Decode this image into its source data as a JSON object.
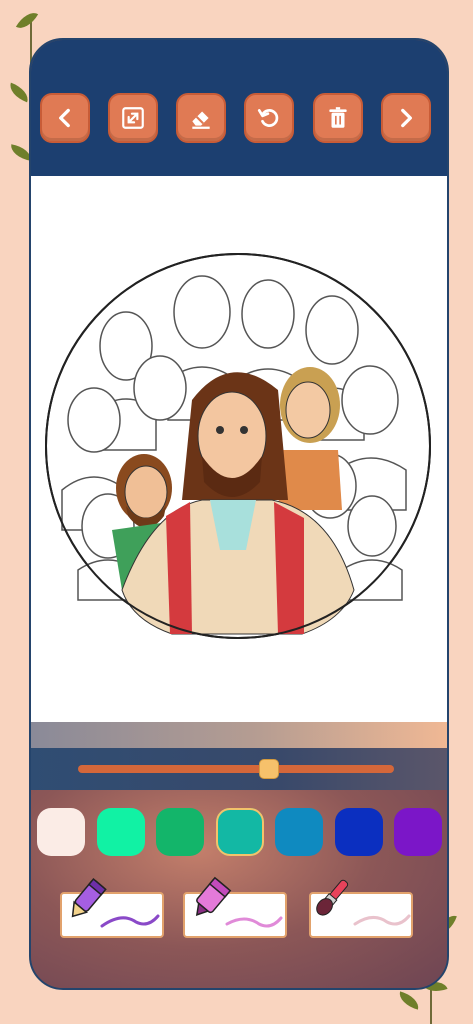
{
  "toolbar": {
    "buttons": [
      {
        "name": "back-button",
        "icon": "chevron-left-icon"
      },
      {
        "name": "resize-button",
        "icon": "resize-icon"
      },
      {
        "name": "eraser-button",
        "icon": "eraser-icon"
      },
      {
        "name": "undo-button",
        "icon": "undo-icon"
      },
      {
        "name": "delete-button",
        "icon": "trash-icon"
      },
      {
        "name": "forward-button",
        "icon": "chevron-right-icon"
      }
    ]
  },
  "canvas": {
    "image": "coloring-page-circle-group-portrait"
  },
  "brush_size": {
    "value_fraction": 0.6
  },
  "palette": {
    "colors": [
      "#fbece6",
      "#11f2a4",
      "#13b56a",
      "#13b8a4",
      "#0f8ac0",
      "#0b2fc0",
      "#7b16c8"
    ],
    "selected_index": 3
  },
  "tools": [
    {
      "name": "pencil-tool",
      "icon": "pencil-icon",
      "accent": "#a55ee2"
    },
    {
      "name": "marker-tool",
      "icon": "marker-icon",
      "accent": "#e47ad9"
    },
    {
      "name": "brush-tool",
      "icon": "paintbrush-icon",
      "accent": "#e8425a"
    }
  ]
}
